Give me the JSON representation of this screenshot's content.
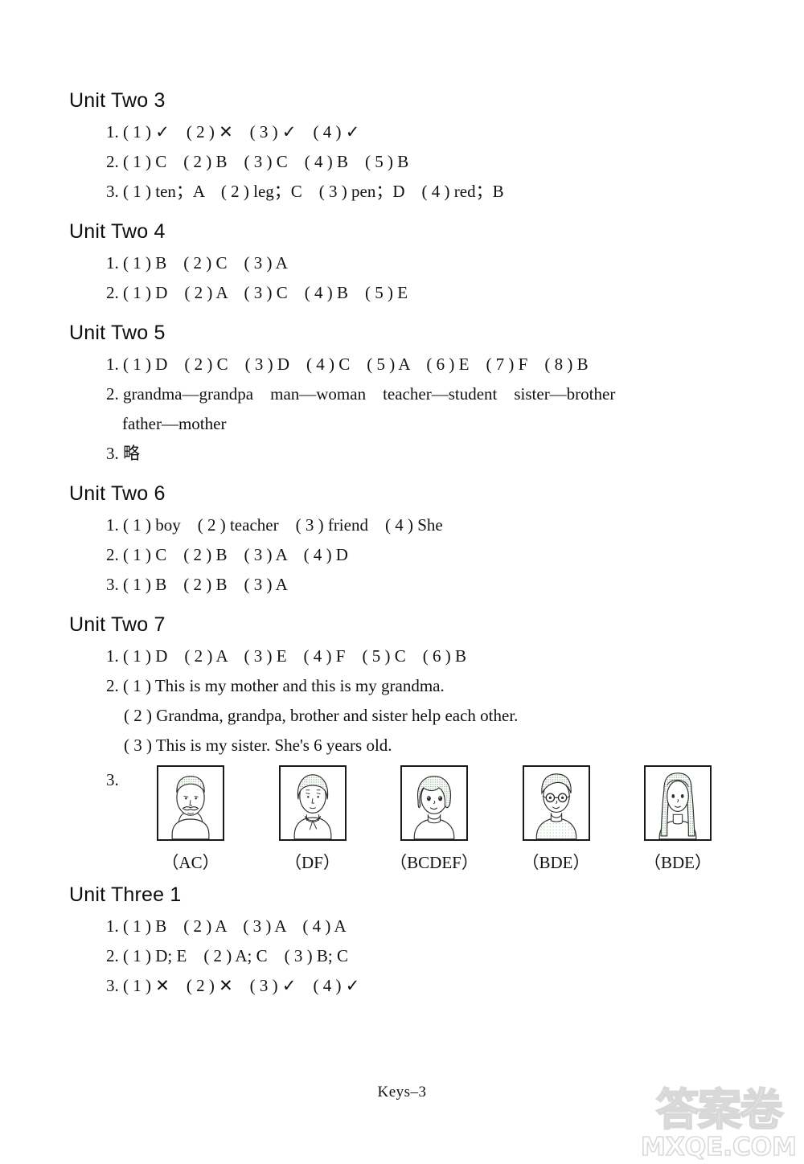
{
  "page": {
    "footer_label": "Keys–3",
    "watermark_cn": "答案卷",
    "watermark_en": "MXQE.COM"
  },
  "sections": [
    {
      "heading": "Unit Two 3",
      "lines": [
        "1. ( 1 ) ✓    ( 2 ) ✕    ( 3 ) ✓    ( 4 ) ✓",
        "2. ( 1 ) C    ( 2 ) B    ( 3 ) C    ( 4 ) B    ( 5 ) B",
        "3. ( 1 ) ten；A    ( 2 ) leg；C    ( 3 ) pen；D    ( 4 ) red；B"
      ]
    },
    {
      "heading": "Unit Two 4",
      "lines": [
        "1. ( 1 ) B    ( 2 ) C    ( 3 ) A",
        "2. ( 1 ) D    ( 2 ) A    ( 3 ) C    ( 4 ) B    ( 5 ) E"
      ]
    },
    {
      "heading": "Unit Two 5",
      "lines": [
        "1. ( 1 ) D    ( 2 ) C    ( 3 ) D    ( 4 ) C    ( 5 ) A    ( 6 ) E    ( 7 ) F    ( 8 ) B",
        "2. grandma—grandpa    man—woman    teacher—student    sister—brother",
        "father—mother",
        "3. 略"
      ],
      "continuation_indexes": [
        2
      ]
    },
    {
      "heading": "Unit Two 6",
      "lines": [
        "1. ( 1 ) boy    ( 2 ) teacher    ( 3 ) friend    ( 4 ) She",
        "2. ( 1 ) C    ( 2 ) B    ( 3 ) A    ( 4 ) D",
        "3. ( 1 ) B    ( 2 ) B    ( 3 ) A"
      ]
    },
    {
      "heading": "Unit Two 7",
      "lines": [
        "1. ( 1 ) D    ( 2 ) A    ( 3 ) E    ( 4 ) F    ( 5 ) C    ( 6 ) B",
        "2. ( 1 ) This is my mother and this is my grandma.",
        "( 2 ) Grandma, grandpa, brother and sister help each other.",
        "( 3 ) This is my sister. She's 6 years old."
      ],
      "sub_indexes": [
        2,
        3
      ],
      "picture_exercise": {
        "number": "3.",
        "items": [
          {
            "figure": "elderly-man-with-mustache",
            "label": "（AC）"
          },
          {
            "figure": "elderly-woman-with-scarf",
            "label": "（DF）"
          },
          {
            "figure": "young-girl-bob-hair",
            "label": "（BCDEF）"
          },
          {
            "figure": "boy-with-glasses",
            "label": "（BDE）"
          },
          {
            "figure": "woman-long-hair",
            "label": "（BDE）"
          }
        ]
      }
    },
    {
      "heading": "Unit Three 1",
      "lines": [
        "1. ( 1 ) B    ( 2 ) A    ( 3 ) A    ( 4 ) A",
        "2. ( 1 ) D; E    ( 2 ) A; C    ( 3 ) B; C",
        "3. ( 1 ) ✕    ( 2 ) ✕    ( 3 ) ✓    ( 4 ) ✓"
      ]
    }
  ]
}
